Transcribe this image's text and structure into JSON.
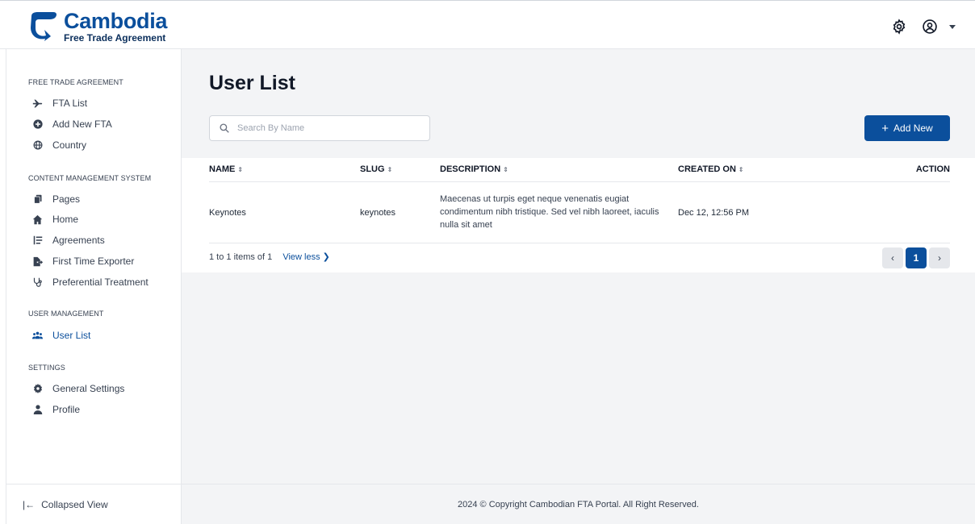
{
  "brand": {
    "title": "Cambodia",
    "subtitle": "Free Trade Agreement",
    "primary_color": "#0b4f9c"
  },
  "header": {
    "icons": [
      "gear-icon",
      "user-circle-icon",
      "caret-down-icon"
    ]
  },
  "sidebar": {
    "sections": [
      {
        "title": "FREE TRADE AGREEMENT"
      },
      {
        "title": "CONTENT MANAGEMENT SYSTEM"
      },
      {
        "title": "USER MANAGEMENT"
      },
      {
        "title": "SETTINGS"
      }
    ],
    "items": [
      {
        "label": "FTA List",
        "icon": "plane-icon"
      },
      {
        "label": "Add New FTA",
        "icon": "plus-circle-icon"
      },
      {
        "label": "Country",
        "icon": "globe-icon"
      },
      {
        "label": "Pages",
        "icon": "copy-icon"
      },
      {
        "label": "Home",
        "icon": "home-icon"
      },
      {
        "label": "Agreements",
        "icon": "list-icon"
      },
      {
        "label": "First Time Exporter",
        "icon": "file-export-icon"
      },
      {
        "label": "Preferential Treatment",
        "icon": "stethoscope-icon"
      },
      {
        "label": "User List",
        "icon": "users-icon",
        "active": true
      },
      {
        "label": "General Settings",
        "icon": "cog-icon"
      },
      {
        "label": "Profile",
        "icon": "user-icon"
      }
    ],
    "collapse_label": "Collapsed View"
  },
  "main": {
    "title": "User List",
    "search_placeholder": "Search By Name",
    "add_button": "Add New",
    "columns": [
      "NAME",
      "SLUG",
      "DESCRIPTION",
      "CREATED ON",
      "ACTION"
    ],
    "rows": [
      {
        "name": "Keynotes",
        "slug": "keynotes",
        "description": "Maecenas ut turpis eget neque venenatis eugiat condimentum nibh tristique. Sed vel nibh laoreet, iaculis nulla sit amet",
        "created_on": "Dec 12, 12:56 PM"
      }
    ],
    "pagination": {
      "info": "1 to 1 items of 1",
      "view_less": "View less ❯",
      "current_page": "1"
    }
  },
  "footer": {
    "copyright": "2024 © Copyright Cambodian FTA Portal. All Right Reserved."
  }
}
